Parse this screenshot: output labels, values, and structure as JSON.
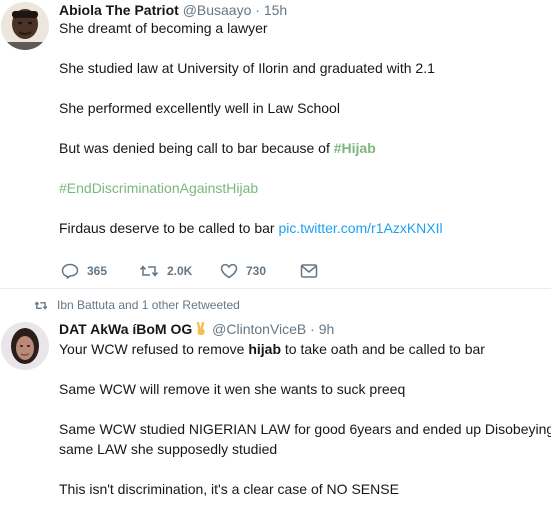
{
  "tweet1": {
    "display_name": "Abiola The Patriot",
    "handle": "@Busaayo",
    "separator": "·",
    "time": "15h",
    "lines": {
      "l1": "She dreamt of becoming a lawyer",
      "l2": "She studied law at University of Ilorin and graduated with 2.1",
      "l3": "She performed excellently well in Law School",
      "l4_prefix": "But was denied being call to bar because of ",
      "l4_hashtag": "#Hijab",
      "l5_hashtag": "#EndDiscriminationAgainstHijab",
      "l6_prefix": "Firdaus deserve to be called to bar ",
      "l6_link": "pic.twitter.com/r1AzxKNXIl"
    },
    "actions": {
      "replies": "365",
      "retweets": "2.0K",
      "likes": "730"
    }
  },
  "retweet_context": {
    "text": "Ibn Battuta and 1 other Retweeted"
  },
  "tweet2": {
    "display_name": "DAT AkWa íBoM OG",
    "handle": "@ClintonViceB",
    "separator": "·",
    "time": "9h",
    "lines": {
      "l1_prefix": "Your WCW refused to remove ",
      "l1_bold": "hijab",
      "l1_suffix": " to take oath and be called to bar",
      "l2": "Same WCW will remove it wen she wants to suck preeq",
      "l3": "Same WCW studied NIGERIAN LAW for good 6years and ended up Disobeying",
      "l4": "same LAW she supposedly studied",
      "l5": "This isn't discrimination, it's a clear case of NO SENSE"
    }
  },
  "colors": {
    "text": "#14171a",
    "muted": "#657786",
    "hashtag": "#79b87a",
    "link": "#1da1f2",
    "divider": "#e6ecf0"
  },
  "icons": [
    "reply-icon",
    "retweet-icon",
    "like-icon",
    "message-icon",
    "victory-hand-icon"
  ]
}
